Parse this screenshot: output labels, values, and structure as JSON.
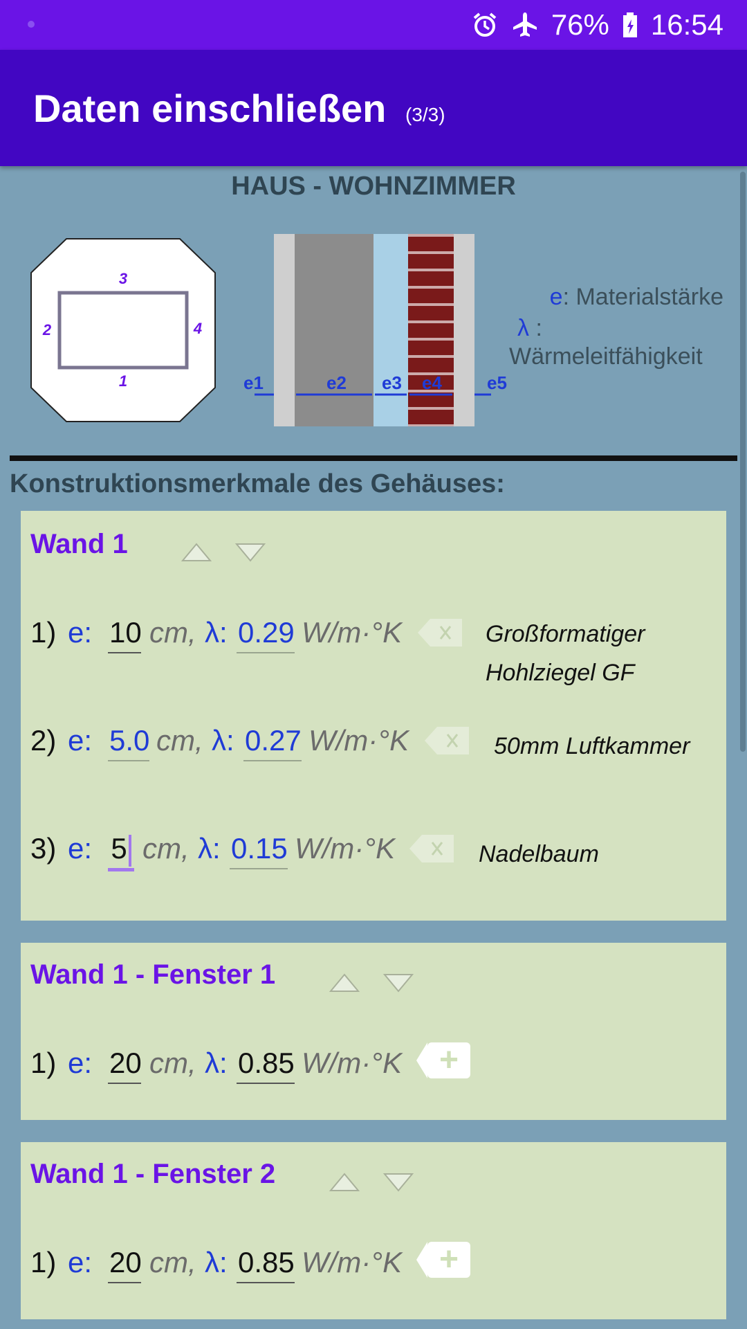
{
  "status": {
    "battery": "76%",
    "time": "16:54"
  },
  "appbar": {
    "title": "Daten einschließen",
    "step": "(3/3)"
  },
  "room_title": "HAUS - WOHNZIMMER",
  "floorplan": {
    "labels": [
      "3",
      "2",
      "4",
      "1"
    ]
  },
  "wall_diagram": {
    "labels": [
      "e1",
      "e2",
      "e3",
      "e4",
      "e5"
    ]
  },
  "legend": {
    "e_symbol": "e",
    "e_text": ": Materialstärke",
    "lambda_symbol": "λ",
    "lambda_colon": ":",
    "lambda_text": "Wärmeleitfähigkeit"
  },
  "section_title": "Konstruktionsmerkmale des Gehäuses:",
  "labels": {
    "e": "e:",
    "lambda": "λ:",
    "cm": "cm,",
    "w_unit": "W/m·°K",
    "delete": "X",
    "add": "+"
  },
  "panels": [
    {
      "title": "Wand 1",
      "layers": [
        {
          "num": "1)",
          "e": "10",
          "lambda": "0.29",
          "material_line1": "Großformatiger",
          "material_line2": "Hohlziegel GF"
        },
        {
          "num": "2)",
          "e": "5.0",
          "lambda": "0.27",
          "material_line1": "50mm Luftkammer",
          "material_line2": ""
        },
        {
          "num": "3)",
          "e": "5",
          "lambda": "0.15",
          "material_line1": "Nadelbaum",
          "material_line2": ""
        }
      ]
    },
    {
      "title": "Wand 1 - Fenster 1",
      "layers": [
        {
          "num": "1)",
          "e": "20",
          "lambda": "0.85"
        }
      ]
    },
    {
      "title": "Wand 1 - Fenster 2",
      "layers": [
        {
          "num": "1)",
          "e": "20",
          "lambda": "0.85"
        }
      ]
    }
  ]
}
